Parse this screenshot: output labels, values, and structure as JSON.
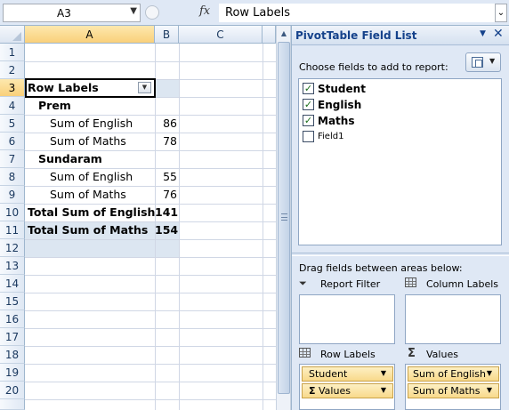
{
  "formula_bar": {
    "name_box": "A3",
    "fx_label": "fx",
    "formula": "Row Labels"
  },
  "grid": {
    "columns": [
      "A",
      "B",
      "C"
    ],
    "row_numbers": [
      "1",
      "2",
      "3",
      "4",
      "5",
      "6",
      "7",
      "8",
      "9",
      "10",
      "11",
      "12",
      "13",
      "14",
      "15",
      "16",
      "17",
      "18",
      "19",
      "20"
    ],
    "rows": [
      {
        "row": 3,
        "a": "Row Labels",
        "b": ""
      },
      {
        "row": 4,
        "a": "Prem",
        "b": ""
      },
      {
        "row": 5,
        "a": "Sum of English",
        "b": "86"
      },
      {
        "row": 6,
        "a": "Sum of Maths",
        "b": "78"
      },
      {
        "row": 7,
        "a": "Sundaram",
        "b": ""
      },
      {
        "row": 8,
        "a": "Sum of English",
        "b": "55"
      },
      {
        "row": 9,
        "a": "Sum of Maths",
        "b": "76"
      },
      {
        "row": 10,
        "a": "Total Sum of English",
        "b": "141"
      },
      {
        "row": 11,
        "a": "Total Sum of Maths",
        "b": "154"
      }
    ]
  },
  "pivot_pane": {
    "title": "PivotTable Field List",
    "choose_label": "Choose fields to add to report:",
    "fields": [
      {
        "label": "Student",
        "checked": "✓"
      },
      {
        "label": "English",
        "checked": "✓"
      },
      {
        "label": "Maths",
        "checked": "✓"
      },
      {
        "label": "Field1",
        "checked": ""
      }
    ],
    "drag_label": "Drag fields between areas below:",
    "areas": {
      "report_filter": "Report Filter",
      "column_labels": "Column Labels",
      "row_labels": "Row Labels",
      "values": "Values"
    },
    "row_items": [
      "Student",
      "Values"
    ],
    "value_items": [
      "Sum of English",
      "Sum of Maths"
    ]
  },
  "colors": {
    "accent": "#15428b",
    "header_bg": "#dfe8f5",
    "band": "#dce6f1",
    "selection": "#f9d07a"
  }
}
